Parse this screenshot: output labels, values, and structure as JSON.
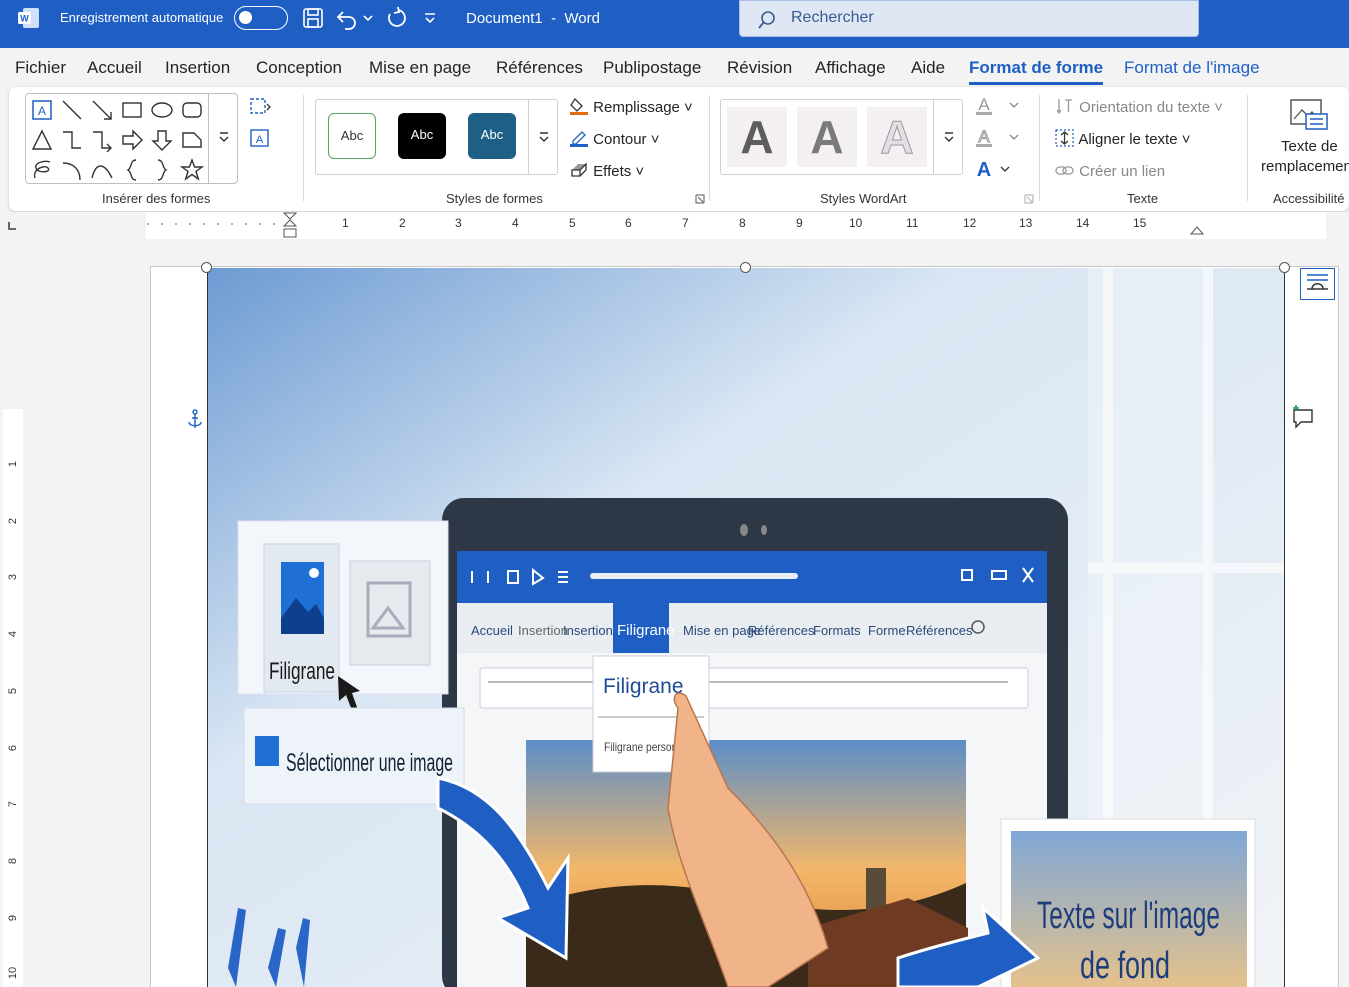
{
  "titlebar": {
    "app_icon": "word-icon",
    "autosave_label": "Enregistrement automatique",
    "doc_name": "Document1",
    "separator": "-",
    "app_name": "Word",
    "search_placeholder": "Rechercher",
    "color": "#1f5fc4"
  },
  "menu": {
    "tabs": [
      {
        "label": "Fichier"
      },
      {
        "label": "Accueil"
      },
      {
        "label": "Insertion"
      },
      {
        "label": "Conception"
      },
      {
        "label": "Mise en page"
      },
      {
        "label": "Références"
      },
      {
        "label": "Publipostage"
      },
      {
        "label": "Révision"
      },
      {
        "label": "Affichage"
      },
      {
        "label": "Aide"
      },
      {
        "label": "Format de forme",
        "active": true
      },
      {
        "label": "Format de l'image"
      }
    ]
  },
  "ribbon": {
    "insert_shapes": {
      "label": "Insérer des formes"
    },
    "shape_styles": {
      "label": "Styles de formes",
      "presets": [
        "Abc",
        "Abc",
        "Abc"
      ],
      "fill": "Remplissage",
      "outline": "Contour",
      "effects": "Effets"
    },
    "wordart": {
      "label": "Styles WordArt",
      "letters": [
        "A",
        "A",
        "A"
      ]
    },
    "text": {
      "label": "Texte",
      "direction": "Orientation du texte",
      "align": "Aligner le texte",
      "link": "Créer un lien"
    },
    "accessibility": {
      "label": "Accessibilité",
      "alt_text_1": "Texte de",
      "alt_text_2": "remplacement"
    }
  },
  "ruler": {
    "numbers": [
      "1",
      "2",
      "3",
      "4",
      "5",
      "6",
      "7",
      "8",
      "9",
      "10",
      "11",
      "12",
      "13",
      "14",
      "15"
    ],
    "vnumbers": [
      "1",
      "2",
      "3",
      "4",
      "5",
      "6",
      "7",
      "8",
      "9",
      "10"
    ]
  },
  "picture": {
    "laptop_tabs": [
      "Accueil",
      "Insertion",
      "Insertion",
      "Filigrane",
      "Mise en page",
      "Références",
      "Formats",
      "Forme",
      "Références"
    ],
    "card_filigrane": "Filigrane",
    "card_select": "Sélectionner une image",
    "dropdown_title": "Filigrane",
    "dropdown_item": "Filigrane personnalisé",
    "overlay_text_1": "Texte sur l'image",
    "overlay_text_2": "de fond"
  }
}
